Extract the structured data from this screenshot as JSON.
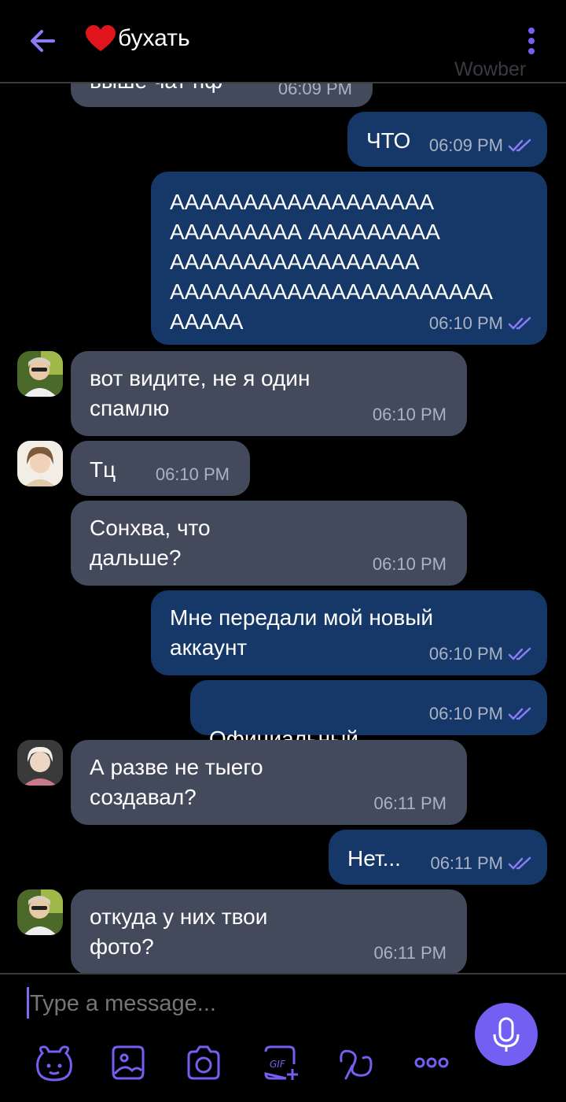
{
  "header": {
    "title": "бухать",
    "watermark": "Wowber"
  },
  "colors": {
    "accent": "#7360f2",
    "incoming_bubble": "#434a5c",
    "outgoing_bubble": "#153868"
  },
  "messages": [
    {
      "dir": "in",
      "text": "выше чат пф",
      "time": "06:09 PM"
    },
    {
      "dir": "out",
      "text": "ЧТО",
      "time": "06:09 PM",
      "read": true
    },
    {
      "dir": "out",
      "text": "АААААААААААААААААА\nААААААААА ААААААААА\nААААААААААААААААА\nАААААААААААААААААААААА\nААААА",
      "time": "06:10 PM",
      "read": true
    },
    {
      "dir": "in",
      "avatar": "user-a",
      "text": "вот видите, не я один\nспамлю",
      "time": "06:10 PM"
    },
    {
      "dir": "in",
      "avatar": "user-b",
      "text": "Тц",
      "time": "06:10 PM"
    },
    {
      "dir": "in",
      "text": "Сонхва, что\nдальше?",
      "time": "06:10 PM"
    },
    {
      "dir": "out",
      "text": "Мне передали мой новый\nаккаунт",
      "time": "06:10 PM",
      "read": true
    },
    {
      "dir": "out",
      "text": "Официальный",
      "emoji": "☝",
      "time": "06:10 PM",
      "read": true
    },
    {
      "dir": "in",
      "avatar": "user-c",
      "text": "А разве не тыего\nсоздавал?",
      "time": "06:11 PM"
    },
    {
      "dir": "out",
      "text": "Нет...",
      "time": "06:11 PM",
      "read": true
    },
    {
      "dir": "in",
      "avatar": "user-a",
      "text": "откуда у них твои\nфото?",
      "time": "06:11 PM"
    }
  ],
  "composer": {
    "placeholder": "Type a message...",
    "tools": [
      "sticker-icon",
      "gallery-icon",
      "camera-icon",
      "gif-icon",
      "doodle-icon",
      "more-icon"
    ],
    "send_icon": "microphone-icon"
  }
}
